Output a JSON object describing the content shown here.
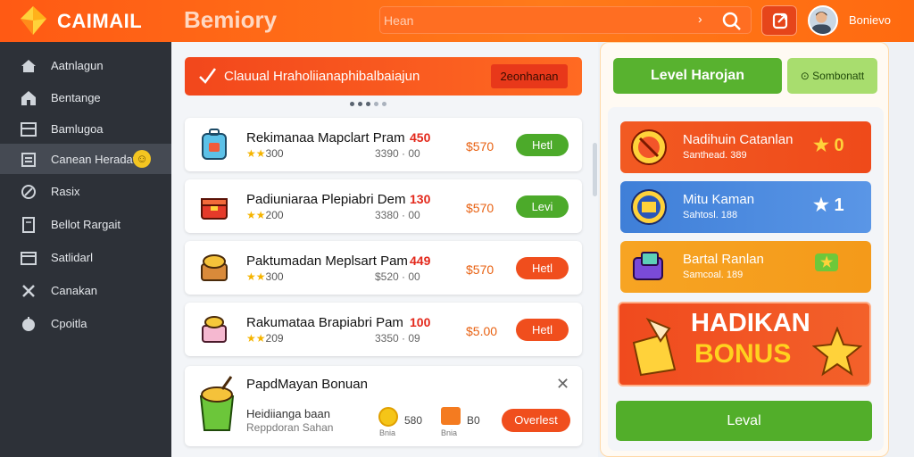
{
  "header": {
    "brand": "CAIMAIL",
    "title": "Bemiory",
    "search_placeholder": "Hean",
    "user_name": "Bonievo"
  },
  "sidebar": {
    "items": [
      {
        "label": "Aatnlagun",
        "icon": "home-icon"
      },
      {
        "label": "Bentange",
        "icon": "house-icon"
      },
      {
        "label": "Bamlugoa",
        "icon": "grid-icon"
      },
      {
        "label": "Canean Heradat",
        "icon": "document-icon",
        "active": true
      },
      {
        "label": "Rasix",
        "icon": "tag-icon"
      },
      {
        "label": "Bellot Rargait",
        "icon": "note-icon"
      },
      {
        "label": "Satlidarl",
        "icon": "calendar-icon"
      },
      {
        "label": "Canakan",
        "icon": "tools-icon"
      },
      {
        "label": "Cpoitla",
        "icon": "apple-icon"
      }
    ]
  },
  "alert": {
    "text": "Clauual Hraholiianaphibalbaiajun",
    "button": "2eonhanan"
  },
  "items": [
    {
      "title": "Rekimanaa Mapclart  Pram",
      "price": "450",
      "rating": "300",
      "sub": "3390  ·  00",
      "amount": "$570",
      "action": "Hetl",
      "action_color": "green"
    },
    {
      "title": "Padiuniaraa Plepiabri  Dem",
      "price": "130",
      "rating": "200",
      "sub": "3380  ·  00",
      "amount": "$570",
      "action": "Levi",
      "action_color": "green"
    },
    {
      "title": "Paktumadan Meplsart  Pam",
      "price": "449",
      "rating": "300",
      "sub": "$520  ·  00",
      "amount": "$570",
      "action": "Hetl",
      "action_color": "red"
    },
    {
      "title": "Rakumataa Brapiabri  Pam",
      "price": "100",
      "rating": "209",
      "sub": "3350  ·  09",
      "amount": "$5.00",
      "action": "Hetl",
      "action_color": "red"
    }
  ],
  "bonus_card": {
    "title": "PapdMayan Bonuan",
    "line1": "Heidiianga baan",
    "line2": "Reppdoran Sahan",
    "coin_value": "580",
    "coin_sub": "Bnia",
    "box_value": "B0",
    "box_sub": "Bnia",
    "button": "Overlest"
  },
  "right": {
    "level_button": "Level Harojan",
    "side_button": "Sombonatt",
    "tiles": [
      {
        "title": "Nadihuin Catanlan",
        "sub": "Santhead. 389",
        "value": "★ 0"
      },
      {
        "title": "Mitu Kaman",
        "sub": "Sahtosl. 188",
        "value": "★ 1"
      },
      {
        "title": "Bartal Ranlan",
        "sub": "Samcoal. 189",
        "value": "★"
      }
    ],
    "promo_line1": "HADIKAN",
    "promo_line2": "BONUS",
    "bottom_button": "Leval"
  },
  "colors": {
    "accent": "#ff5a14",
    "green": "#52ae2a",
    "sidebar": "#2d3138"
  }
}
